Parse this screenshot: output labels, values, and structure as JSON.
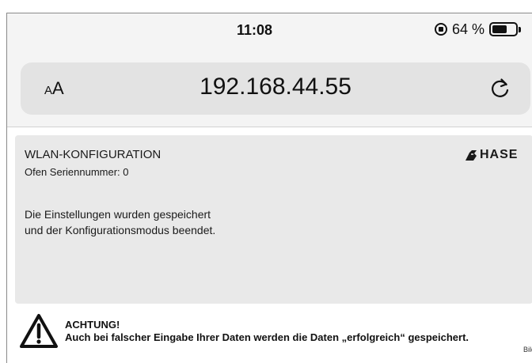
{
  "status_bar": {
    "time": "11:08",
    "battery_percent": "64 %",
    "battery_level": 0.64
  },
  "browser": {
    "aa_small": "A",
    "aa_large": "A",
    "url": "192.168.44.55"
  },
  "panel": {
    "title": "WLAN-KONFIGURATION",
    "serial_label": "Ofen Seriennummer: 0",
    "brand": "HASE",
    "message_line1": "Die Einstellungen wurden gespeichert",
    "message_line2": "und der Konfigurationsmodus beendet."
  },
  "warning": {
    "heading": "ACHTUNG!",
    "text": "Auch bei falscher Eingabe Ihrer Daten werden die Daten „erfolgreich“ gespeichert."
  },
  "figure_label": "Bild",
  "colors": {
    "chrome_bg": "#f4f4f4",
    "url_bar_bg": "#e3e3e3",
    "panel_bg": "#e9e9e9",
    "text": "#1a1a1a"
  }
}
